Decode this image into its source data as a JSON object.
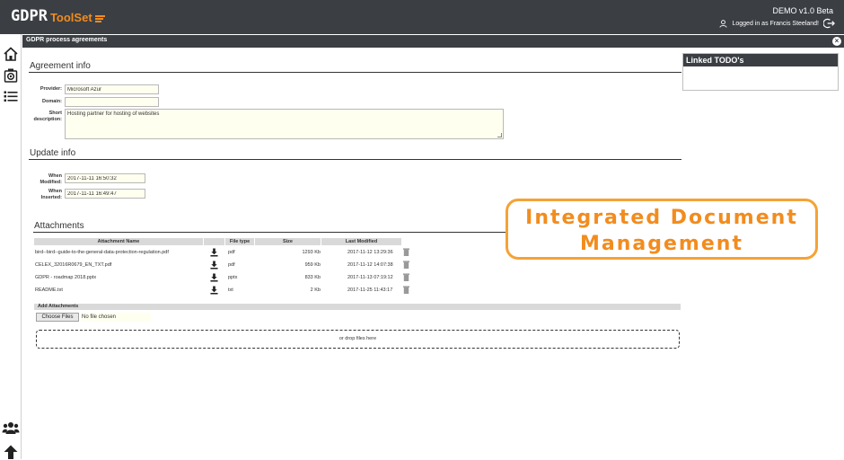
{
  "app": {
    "logo_main": "GDPR",
    "logo_accent": "ToolSet",
    "version": "DEMO v1.0 Beta",
    "user_text": "Logged in as Francis Steeland!"
  },
  "sidebar": {
    "top_icons": [
      "home-icon",
      "camera-settings-icon",
      "list-icon"
    ],
    "bottom_icons": [
      "users-icon",
      "arrow-up-icon"
    ]
  },
  "panel": {
    "title": "GDPR process agreements"
  },
  "agreement_info": {
    "section_title": "Agreement info",
    "provider_label": "Provider:",
    "provider_value": "Microsoft Azur",
    "domain_label": "Domain:",
    "domain_value": "",
    "short_desc_label_1": "Short",
    "short_desc_label_2": "description:",
    "short_desc_value": "Hosting partner for hosting of websites"
  },
  "update_info": {
    "section_title": "Update info",
    "modified_label_1": "When",
    "modified_label_2": "Modified:",
    "modified_value": "2017-11-11 16:50:32",
    "inserted_label_1": "When",
    "inserted_label_2": "Inserted:",
    "inserted_value": "2017-11-11 16:49:47"
  },
  "attachments": {
    "section_title": "Attachments",
    "columns": {
      "name": "Attachment Name",
      "type": "File type",
      "size": "Size",
      "modified": "Last Modified"
    },
    "rows": [
      {
        "name": "bird--bird--guide-to-the-general-data-protection-regulation.pdf",
        "type": "pdf",
        "size": "1293 Kb",
        "modified": "2017-11-12 13:29:36"
      },
      {
        "name": "CELEX_32016R0679_EN_TXT.pdf",
        "type": "pdf",
        "size": "959 Kb",
        "modified": "2017-11-12 14:07:38"
      },
      {
        "name": "GDPR - roadmap 2018.pptx",
        "type": "pptx",
        "size": "833 Kb",
        "modified": "2017-11-13 07:19:12"
      },
      {
        "name": "README.txt",
        "type": "txt",
        "size": "2 Kb",
        "modified": "2017-11-25 11:43:17"
      }
    ],
    "add_title": "Add Attachments",
    "choose_button": "Choose Files",
    "no_file": "No file chosen",
    "drop_text": "or drop files here"
  },
  "todo": {
    "title": "Linked TODO's"
  },
  "banner": {
    "line1": "Integrated Document",
    "line2": "Management"
  },
  "colors": {
    "header_bg": "#3b3f44",
    "accent": "#f28c1e",
    "input_bg": "#fffff0"
  }
}
